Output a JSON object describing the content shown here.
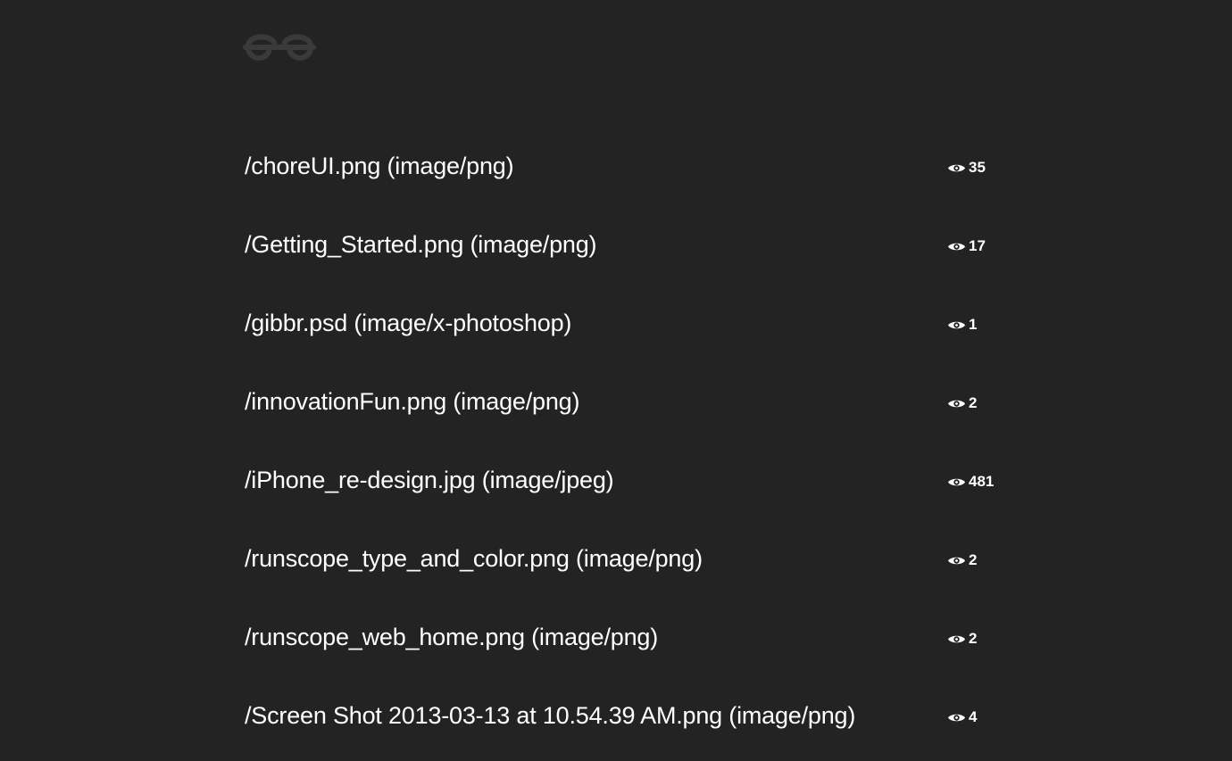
{
  "brand": {
    "logo_icon": "glasses-icon",
    "logo_color": "#3a3a3a"
  },
  "colors": {
    "background": "#232323",
    "text": "#ffffff"
  },
  "files": [
    {
      "label": "/choreUI.png (image/png)",
      "views": "35"
    },
    {
      "label": "/Getting_Started.png (image/png)",
      "views": "17"
    },
    {
      "label": "/gibbr.psd (image/x-photoshop)",
      "views": "1"
    },
    {
      "label": "/innovationFun.png (image/png)",
      "views": "2"
    },
    {
      "label": "/iPhone_re-design.jpg (image/jpeg)",
      "views": "481"
    },
    {
      "label": "/runscope_type_and_color.png (image/png)",
      "views": "2"
    },
    {
      "label": "/runscope_web_home.png (image/png)",
      "views": "2"
    },
    {
      "label": "/Screen Shot 2013-03-13 at 10.54.39 AM.png (image/png)",
      "views": "4"
    }
  ],
  "icons": {
    "views": "eye-icon"
  }
}
